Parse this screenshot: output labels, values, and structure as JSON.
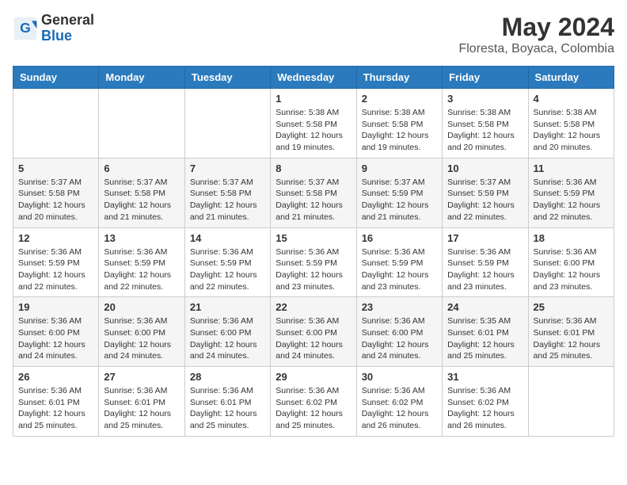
{
  "header": {
    "logo_general": "General",
    "logo_blue": "Blue",
    "month_year": "May 2024",
    "location": "Floresta, Boyaca, Colombia"
  },
  "weekdays": [
    "Sunday",
    "Monday",
    "Tuesday",
    "Wednesday",
    "Thursday",
    "Friday",
    "Saturday"
  ],
  "weeks": [
    [
      {
        "day": "",
        "info": ""
      },
      {
        "day": "",
        "info": ""
      },
      {
        "day": "",
        "info": ""
      },
      {
        "day": "1",
        "info": "Sunrise: 5:38 AM\nSunset: 5:58 PM\nDaylight: 12 hours\nand 19 minutes."
      },
      {
        "day": "2",
        "info": "Sunrise: 5:38 AM\nSunset: 5:58 PM\nDaylight: 12 hours\nand 19 minutes."
      },
      {
        "day": "3",
        "info": "Sunrise: 5:38 AM\nSunset: 5:58 PM\nDaylight: 12 hours\nand 20 minutes."
      },
      {
        "day": "4",
        "info": "Sunrise: 5:38 AM\nSunset: 5:58 PM\nDaylight: 12 hours\nand 20 minutes."
      }
    ],
    [
      {
        "day": "5",
        "info": "Sunrise: 5:37 AM\nSunset: 5:58 PM\nDaylight: 12 hours\nand 20 minutes."
      },
      {
        "day": "6",
        "info": "Sunrise: 5:37 AM\nSunset: 5:58 PM\nDaylight: 12 hours\nand 21 minutes."
      },
      {
        "day": "7",
        "info": "Sunrise: 5:37 AM\nSunset: 5:58 PM\nDaylight: 12 hours\nand 21 minutes."
      },
      {
        "day": "8",
        "info": "Sunrise: 5:37 AM\nSunset: 5:58 PM\nDaylight: 12 hours\nand 21 minutes."
      },
      {
        "day": "9",
        "info": "Sunrise: 5:37 AM\nSunset: 5:59 PM\nDaylight: 12 hours\nand 21 minutes."
      },
      {
        "day": "10",
        "info": "Sunrise: 5:37 AM\nSunset: 5:59 PM\nDaylight: 12 hours\nand 22 minutes."
      },
      {
        "day": "11",
        "info": "Sunrise: 5:36 AM\nSunset: 5:59 PM\nDaylight: 12 hours\nand 22 minutes."
      }
    ],
    [
      {
        "day": "12",
        "info": "Sunrise: 5:36 AM\nSunset: 5:59 PM\nDaylight: 12 hours\nand 22 minutes."
      },
      {
        "day": "13",
        "info": "Sunrise: 5:36 AM\nSunset: 5:59 PM\nDaylight: 12 hours\nand 22 minutes."
      },
      {
        "day": "14",
        "info": "Sunrise: 5:36 AM\nSunset: 5:59 PM\nDaylight: 12 hours\nand 22 minutes."
      },
      {
        "day": "15",
        "info": "Sunrise: 5:36 AM\nSunset: 5:59 PM\nDaylight: 12 hours\nand 23 minutes."
      },
      {
        "day": "16",
        "info": "Sunrise: 5:36 AM\nSunset: 5:59 PM\nDaylight: 12 hours\nand 23 minutes."
      },
      {
        "day": "17",
        "info": "Sunrise: 5:36 AM\nSunset: 5:59 PM\nDaylight: 12 hours\nand 23 minutes."
      },
      {
        "day": "18",
        "info": "Sunrise: 5:36 AM\nSunset: 6:00 PM\nDaylight: 12 hours\nand 23 minutes."
      }
    ],
    [
      {
        "day": "19",
        "info": "Sunrise: 5:36 AM\nSunset: 6:00 PM\nDaylight: 12 hours\nand 24 minutes."
      },
      {
        "day": "20",
        "info": "Sunrise: 5:36 AM\nSunset: 6:00 PM\nDaylight: 12 hours\nand 24 minutes."
      },
      {
        "day": "21",
        "info": "Sunrise: 5:36 AM\nSunset: 6:00 PM\nDaylight: 12 hours\nand 24 minutes."
      },
      {
        "day": "22",
        "info": "Sunrise: 5:36 AM\nSunset: 6:00 PM\nDaylight: 12 hours\nand 24 minutes."
      },
      {
        "day": "23",
        "info": "Sunrise: 5:36 AM\nSunset: 6:00 PM\nDaylight: 12 hours\nand 24 minutes."
      },
      {
        "day": "24",
        "info": "Sunrise: 5:35 AM\nSunset: 6:01 PM\nDaylight: 12 hours\nand 25 minutes."
      },
      {
        "day": "25",
        "info": "Sunrise: 5:36 AM\nSunset: 6:01 PM\nDaylight: 12 hours\nand 25 minutes."
      }
    ],
    [
      {
        "day": "26",
        "info": "Sunrise: 5:36 AM\nSunset: 6:01 PM\nDaylight: 12 hours\nand 25 minutes."
      },
      {
        "day": "27",
        "info": "Sunrise: 5:36 AM\nSunset: 6:01 PM\nDaylight: 12 hours\nand 25 minutes."
      },
      {
        "day": "28",
        "info": "Sunrise: 5:36 AM\nSunset: 6:01 PM\nDaylight: 12 hours\nand 25 minutes."
      },
      {
        "day": "29",
        "info": "Sunrise: 5:36 AM\nSunset: 6:02 PM\nDaylight: 12 hours\nand 25 minutes."
      },
      {
        "day": "30",
        "info": "Sunrise: 5:36 AM\nSunset: 6:02 PM\nDaylight: 12 hours\nand 26 minutes."
      },
      {
        "day": "31",
        "info": "Sunrise: 5:36 AM\nSunset: 6:02 PM\nDaylight: 12 hours\nand 26 minutes."
      },
      {
        "day": "",
        "info": ""
      }
    ]
  ]
}
